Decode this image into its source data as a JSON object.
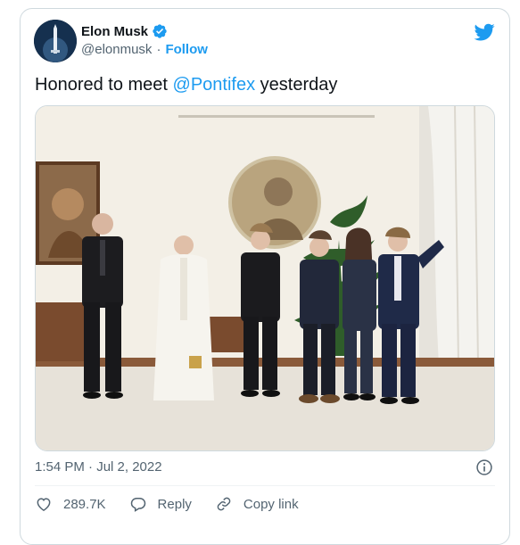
{
  "author": {
    "name": "Elon Musk",
    "handle": "@elonmusk",
    "separator": "·",
    "follow_label": "Follow",
    "verified_color": "#1d9bf0"
  },
  "tweet": {
    "text_before": "Honored to meet ",
    "mention": "@Pontifex",
    "text_after": " yesterday",
    "timestamp": "1:54 PM · Jul 2, 2022"
  },
  "actions": {
    "like_count": "289.7K",
    "reply_label": "Reply",
    "copy_link_label": "Copy link"
  },
  "icons": [
    "twitter-bird-icon",
    "verified-badge-icon",
    "info-icon",
    "heart-icon",
    "reply-icon",
    "link-icon"
  ],
  "colors": {
    "accent": "#1d9bf0",
    "muted": "#536471",
    "border": "#cfd9de"
  }
}
